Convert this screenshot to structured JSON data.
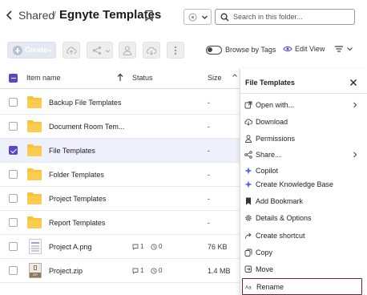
{
  "header": {
    "breadcrumb_parent": "Shared",
    "breadcrumb_sep": "/",
    "title": "Egnyte Templates",
    "search_placeholder": "Search in this folder..."
  },
  "toolbar": {
    "create_label": "Create",
    "browse_by_tags_label": "Browse by Tags",
    "browse_by_tags_on": false,
    "edit_view_label": "Edit View"
  },
  "table": {
    "columns": {
      "name": "Item name",
      "status": "Status",
      "size": "Size"
    },
    "rows": [
      {
        "name": "Backup File Templates",
        "type": "folder",
        "size": "-",
        "selected": false
      },
      {
        "name": "Document Room Tem...",
        "type": "folder",
        "size": "-",
        "selected": false
      },
      {
        "name": "File Templates",
        "type": "folder",
        "size": "-",
        "selected": true
      },
      {
        "name": "Folder Templates",
        "type": "folder",
        "size": "-",
        "selected": false
      },
      {
        "name": "Project Templates",
        "type": "folder",
        "size": "-",
        "selected": false
      },
      {
        "name": "Report Templates",
        "type": "folder",
        "size": "-",
        "selected": false
      },
      {
        "name": "Project A.png",
        "type": "png",
        "size": "76 KB",
        "comments": "1",
        "versions": "0",
        "selected": false
      },
      {
        "name": "Project.zip",
        "type": "zip",
        "size": "1.4 MB",
        "comments": "1",
        "versions": "0",
        "zip_tag": "ZIP",
        "selected": false
      }
    ]
  },
  "context_menu": {
    "title": "File Templates",
    "items": [
      {
        "label": "Open with...",
        "icon": "open-external-icon",
        "submenu": true
      },
      {
        "label": "Download",
        "icon": "download-icon",
        "submenu": false
      },
      {
        "label": "Permissions",
        "icon": "person-icon",
        "submenu": false
      },
      {
        "label": "Share...",
        "icon": "share-icon",
        "submenu": true
      },
      {
        "label": "Copilot",
        "icon": "sparkle-icon",
        "submenu": false
      },
      {
        "label": "Create Knowledge Base",
        "icon": "sparkle-icon",
        "submenu": false
      },
      {
        "label": "Add Bookmark",
        "icon": "bookmark-filled-icon",
        "submenu": false
      },
      {
        "label": "Details & Options",
        "icon": "gear-icon",
        "submenu": false
      },
      {
        "label": "Create shortcut",
        "icon": "shortcut-icon",
        "submenu": false
      },
      {
        "label": "Copy",
        "icon": "copy-icon",
        "submenu": false
      },
      {
        "label": "Move",
        "icon": "move-icon",
        "submenu": false
      },
      {
        "label": "Rename",
        "icon": "rename-icon",
        "submenu": false,
        "highlighted": true
      }
    ]
  },
  "colors": {
    "accent": "#5b47c6",
    "folder": "#f7c23e",
    "selected_row": "#eef0fb",
    "rename_border": "#7a1f3a"
  }
}
